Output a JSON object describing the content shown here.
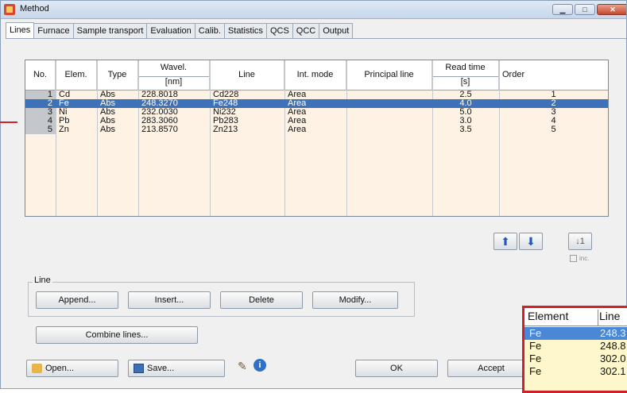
{
  "window": {
    "title": "Method",
    "min_icon": "minimize-icon",
    "max_icon": "maximize-icon",
    "close_icon": "close-icon"
  },
  "tabs": [
    "Lines",
    "Furnace",
    "Sample transport",
    "Evaluation",
    "Calib.",
    "Statistics",
    "QCS",
    "QCC",
    "Output"
  ],
  "grid": {
    "headers": {
      "no": "No.",
      "elem": "Elem.",
      "type": "Type",
      "wavel": "Wavel.",
      "wavel_unit": "[nm]",
      "line": "Line",
      "int_mode": "Int. mode",
      "principal_line": "Principal line",
      "read_time": "Read time",
      "read_time_unit": "[s]",
      "order": "Order"
    },
    "rows": [
      {
        "no": "1",
        "elem": "Cd",
        "type": "Abs",
        "wavel": "228.8018",
        "line": "Cd228",
        "int_mode": "Area",
        "principal": "",
        "read_time": "2.5",
        "order": "1"
      },
      {
        "no": "2",
        "elem": "Fe",
        "type": "Abs",
        "wavel": "248.3270",
        "line": "Fe248",
        "int_mode": "Area",
        "principal": "",
        "read_time": "4.0",
        "order": "2"
      },
      {
        "no": "3",
        "elem": "Ni",
        "type": "Abs",
        "wavel": "232.0030",
        "line": "Ni232",
        "int_mode": "Area",
        "principal": "",
        "read_time": "5.0",
        "order": "3"
      },
      {
        "no": "4",
        "elem": "Pb",
        "type": "Abs",
        "wavel": "283.3060",
        "line": "Pb283",
        "int_mode": "Area",
        "principal": "",
        "read_time": "3.0",
        "order": "4"
      },
      {
        "no": "5",
        "elem": "Zn",
        "type": "Abs",
        "wavel": "213.8570",
        "line": "Zn213",
        "int_mode": "Area",
        "principal": "",
        "read_time": "3.5",
        "order": "5"
      }
    ],
    "selected_row": 2
  },
  "order_controls": {
    "up_icon": "arrow-up-icon",
    "down_icon": "arrow-down-icon",
    "sort_icon": "sort-icon",
    "inc_label": "inc."
  },
  "line_group": {
    "label": "Line",
    "append": "Append...",
    "insert": "Insert...",
    "delete": "Delete",
    "modify": "Modify..."
  },
  "combine": "Combine lines...",
  "footer": {
    "open": "Open...",
    "save": "Save...",
    "ok": "OK",
    "accept": "Accept",
    "open_icon": "folder-icon",
    "save_icon": "disk-icon"
  },
  "inset": {
    "headers": {
      "element": "Element",
      "line": "Line"
    },
    "rows": [
      {
        "element": "Fe",
        "line": "248.3",
        "selected": true
      },
      {
        "element": "Fe",
        "line": "248.8"
      },
      {
        "element": "Fe",
        "line": "302.0"
      },
      {
        "element": "Fe",
        "line": "302.1"
      }
    ]
  }
}
